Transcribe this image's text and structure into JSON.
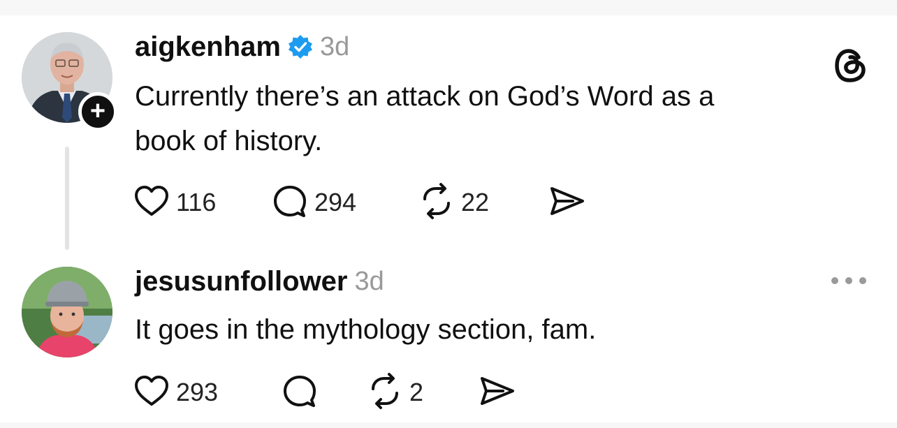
{
  "posts": [
    {
      "username": "aigkenham",
      "verified": true,
      "time": "3d",
      "text_line1": "Currently there’s an attack on God’s Word as a",
      "text_line2": "book of history.",
      "likes": "116",
      "replies": "294",
      "reposts": "22",
      "follow_badge": "+"
    },
    {
      "username": "jesusunfollower",
      "time": "3d",
      "text_line1": "It goes in the mythology section, fam.",
      "likes": "293",
      "replies": "",
      "reposts": "2"
    }
  ],
  "icons": {
    "like": "heart-icon",
    "reply": "comment-icon",
    "repost": "repost-icon",
    "share": "send-icon",
    "app": "threads-logo-icon",
    "more": "more-dots-icon",
    "verified": "verified-badge-icon"
  },
  "colors": {
    "verified": "#1d9bf0",
    "timestamp": "#999999",
    "text": "#101010"
  }
}
